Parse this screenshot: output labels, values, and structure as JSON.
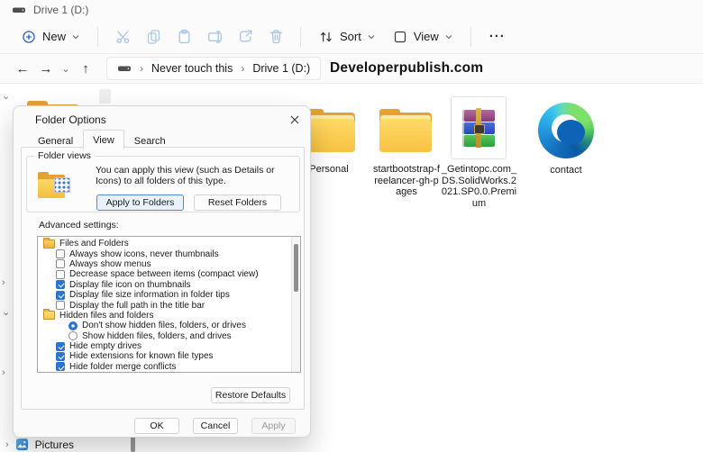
{
  "window": {
    "title": "Drive 1 (D:)"
  },
  "colors": {
    "accent_blue": "#2a74d2",
    "folder_yellow": "#f8c242",
    "toolbar_icon_blue": "#abc8e8",
    "edge_blue": "#0d63b6",
    "watermark_text": "#121212"
  },
  "icons": {
    "titlebar": [
      "drive-icon"
    ],
    "toolbar": [
      "new-plus-circle-icon",
      "cut-icon",
      "copy-icon",
      "paste-icon",
      "rename-icon",
      "share-icon",
      "delete-icon",
      "sort-arrows-icon",
      "view-square-icon",
      "more-ellipsis-icon"
    ],
    "navigation": [
      "back-arrow-icon",
      "forward-arrow-icon",
      "recent-chevron-icon",
      "up-arrow-icon"
    ],
    "files": [
      "folder-icon",
      "winrar-archive-icon",
      "edge-browser-icon",
      "pictures-icon"
    ]
  },
  "toolbar": {
    "new_label": "New",
    "sort_label": "Sort",
    "view_label": "View",
    "more_label": "···"
  },
  "breadcrumb": {
    "crumbs": [
      "Never touch this",
      "Drive 1 (D:)"
    ]
  },
  "watermark": "Developerpublish.com",
  "files": [
    {
      "name": "Personal",
      "type": "folder"
    },
    {
      "name": "startbootstrap-freelancer-gh-pages",
      "type": "folder"
    },
    {
      "name": "_Getintopc.com_DS.SolidWorks.2021.SP0.0.Premium",
      "type": "rar-archive"
    },
    {
      "name": "contact",
      "type": "edge-html"
    }
  ],
  "sidebar": {
    "pictures_label": "Pictures"
  },
  "dialog": {
    "title": "Folder Options",
    "tabs": [
      {
        "label": "General",
        "active": false
      },
      {
        "label": "View",
        "active": true
      },
      {
        "label": "Search",
        "active": false
      }
    ],
    "folder_views": {
      "legend": "Folder views",
      "description": "You can apply this view (such as Details or Icons) to all folders of this type.",
      "apply_button": "Apply to Folders",
      "reset_button": "Reset Folders"
    },
    "advanced": {
      "label": "Advanced settings:",
      "items": [
        {
          "type": "group",
          "checked": null,
          "label": "Files and Folders"
        },
        {
          "type": "checkbox",
          "checked": false,
          "label": "Always show icons, never thumbnails"
        },
        {
          "type": "checkbox",
          "checked": false,
          "label": "Always show menus"
        },
        {
          "type": "checkbox",
          "checked": false,
          "label": "Decrease space between items (compact view)"
        },
        {
          "type": "checkbox",
          "checked": true,
          "label": "Display file icon on thumbnails"
        },
        {
          "type": "checkbox",
          "checked": true,
          "label": "Display file size information in folder tips"
        },
        {
          "type": "checkbox",
          "checked": false,
          "label": "Display the full path in the title bar"
        },
        {
          "type": "group-open",
          "checked": null,
          "label": "Hidden files and folders"
        },
        {
          "type": "radio",
          "checked": true,
          "label": "Don't show hidden files, folders, or drives"
        },
        {
          "type": "radio",
          "checked": false,
          "label": "Show hidden files, folders, and drives"
        },
        {
          "type": "checkbox",
          "checked": true,
          "label": "Hide empty drives"
        },
        {
          "type": "checkbox",
          "checked": true,
          "label": "Hide extensions for known file types"
        },
        {
          "type": "checkbox",
          "checked": true,
          "label": "Hide folder merge conflicts"
        },
        {
          "type": "checkbox",
          "checked": true,
          "label": ""
        }
      ]
    },
    "restore_button": "Restore Defaults",
    "ok_button": "OK",
    "cancel_button": "Cancel",
    "apply_button": "Apply"
  }
}
